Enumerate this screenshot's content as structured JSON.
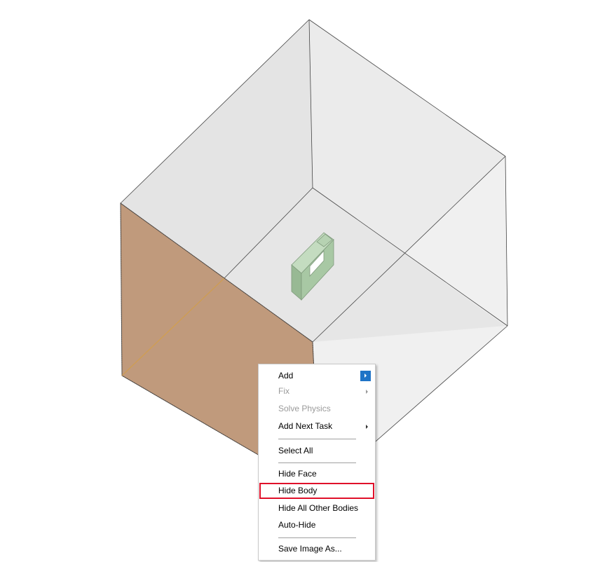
{
  "scene": {
    "box_face_highlight_color": "#c09a7c",
    "model_color": "#a8c8a4"
  },
  "context_menu": {
    "items": [
      {
        "label": "Add",
        "submenu": true,
        "disabled": false
      },
      {
        "label": "Fix",
        "submenu": true,
        "disabled": true
      },
      {
        "label": "Solve Physics",
        "submenu": false,
        "disabled": true
      },
      {
        "label": "Add Next Task",
        "submenu": true,
        "disabled": false
      },
      {
        "label": "Select All",
        "submenu": false,
        "disabled": false
      },
      {
        "label": "Hide Face",
        "submenu": false,
        "disabled": false
      },
      {
        "label": "Hide Body",
        "submenu": false,
        "disabled": false,
        "highlighted": true
      },
      {
        "label": "Hide All Other Bodies",
        "submenu": false,
        "disabled": false
      },
      {
        "label": "Auto-Hide",
        "submenu": false,
        "disabled": false
      },
      {
        "label": "Save Image As...",
        "submenu": false,
        "disabled": false
      }
    ],
    "highlight_color": "#e0102a",
    "submenu_accent": "#1f74c7"
  }
}
